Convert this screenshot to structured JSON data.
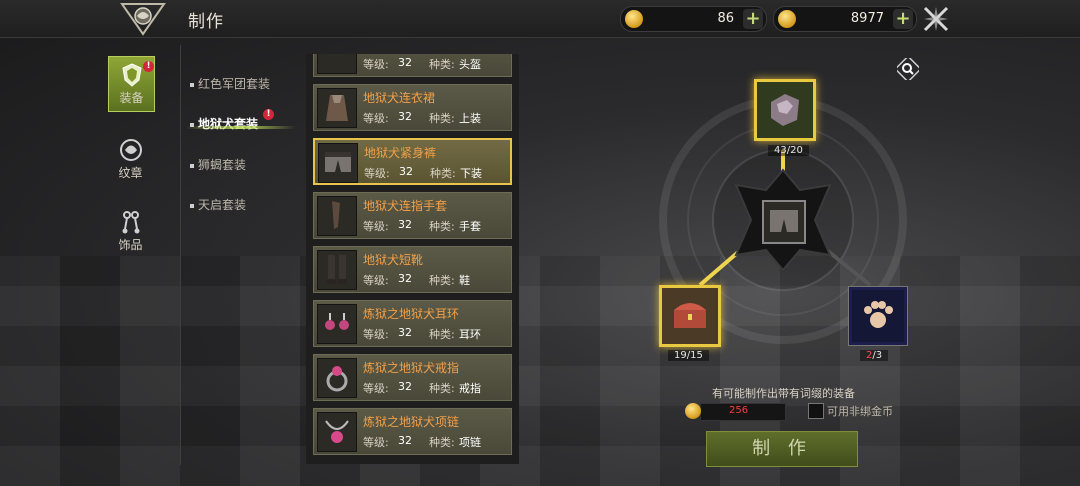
{
  "header": {
    "title": "制作",
    "currency1": {
      "value": "86"
    },
    "currency2": {
      "value": "8977"
    }
  },
  "tabs": [
    {
      "label": "装备",
      "active": true
    },
    {
      "label": "纹章",
      "active": false
    },
    {
      "label": "饰品",
      "active": false
    }
  ],
  "subcategories": [
    {
      "label": "红色军团套装",
      "active": false
    },
    {
      "label": "地狱犬套装",
      "active": true
    },
    {
      "label": "狮蝎套装",
      "active": false
    },
    {
      "label": "天启套装",
      "active": false
    }
  ],
  "items": [
    {
      "name": "",
      "level_label": "等级:",
      "level": "32",
      "type_label": "种类:",
      "type": "头盔"
    },
    {
      "name": "地狱犬连衣裙",
      "level_label": "等级:",
      "level": "32",
      "type_label": "种类:",
      "type": "上装"
    },
    {
      "name": "地狱犬紧身裤",
      "level_label": "等级:",
      "level": "32",
      "type_label": "种类:",
      "type": "下装",
      "selected": true
    },
    {
      "name": "地狱犬连指手套",
      "level_label": "等级:",
      "level": "32",
      "type_label": "种类:",
      "type": "手套"
    },
    {
      "name": "地狱犬短靴",
      "level_label": "等级:",
      "level": "32",
      "type_label": "种类:",
      "type": "鞋"
    },
    {
      "name": "炼狱之地狱犬耳环",
      "level_label": "等级:",
      "level": "32",
      "type_label": "种类:",
      "type": "耳环"
    },
    {
      "name": "炼狱之地狱犬戒指",
      "level_label": "等级:",
      "level": "32",
      "type_label": "种类:",
      "type": "戒指"
    },
    {
      "name": "炼狱之地狱犬项链",
      "level_label": "等级:",
      "level": "32",
      "type_label": "种类:",
      "type": "项链"
    }
  ],
  "materials": {
    "top": {
      "count": "43/20"
    },
    "left": {
      "count": "19/15"
    },
    "right": {
      "have": "2",
      "need": "/3"
    }
  },
  "craft_panel": {
    "note": "有可能制作出带有词缀的装备",
    "cost": "256",
    "checkbox_label": "可用非绑金币",
    "craft_button": "制 作"
  },
  "colors": {
    "accent_green": "#8ea636",
    "gold_border": "#e9c93f",
    "item_name": "#f0a04a",
    "insufficient": "#ff3a3a"
  }
}
